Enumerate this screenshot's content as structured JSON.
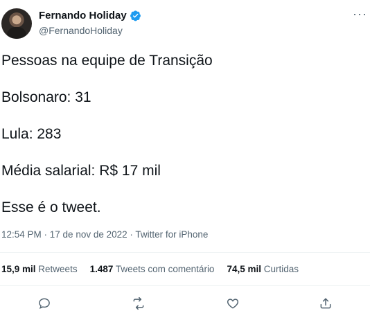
{
  "user": {
    "display_name": "Fernando Holiday",
    "handle": "@FernandoHoliday"
  },
  "tweet": {
    "lines": [
      "Pessoas na equipe de Transição",
      "Bolsonaro: 31",
      "Lula: 283",
      "Média salarial: R$ 17 mil",
      "Esse é o tweet."
    ],
    "meta": "12:54 PM · 17 de nov de 2022 · Twitter for iPhone"
  },
  "stats": {
    "retweets_count": "15,9 mil",
    "retweets_label": "Retweets",
    "quotes_count": "1.487",
    "quotes_label": "Tweets com comentário",
    "likes_count": "74,5 mil",
    "likes_label": "Curtidas"
  },
  "colors": {
    "verified": "#1d9bf0",
    "muted": "#536471",
    "text": "#0f1419"
  },
  "icons": {
    "reply": "reply-icon",
    "retweet": "retweet-icon",
    "like": "like-icon",
    "share": "share-icon"
  }
}
